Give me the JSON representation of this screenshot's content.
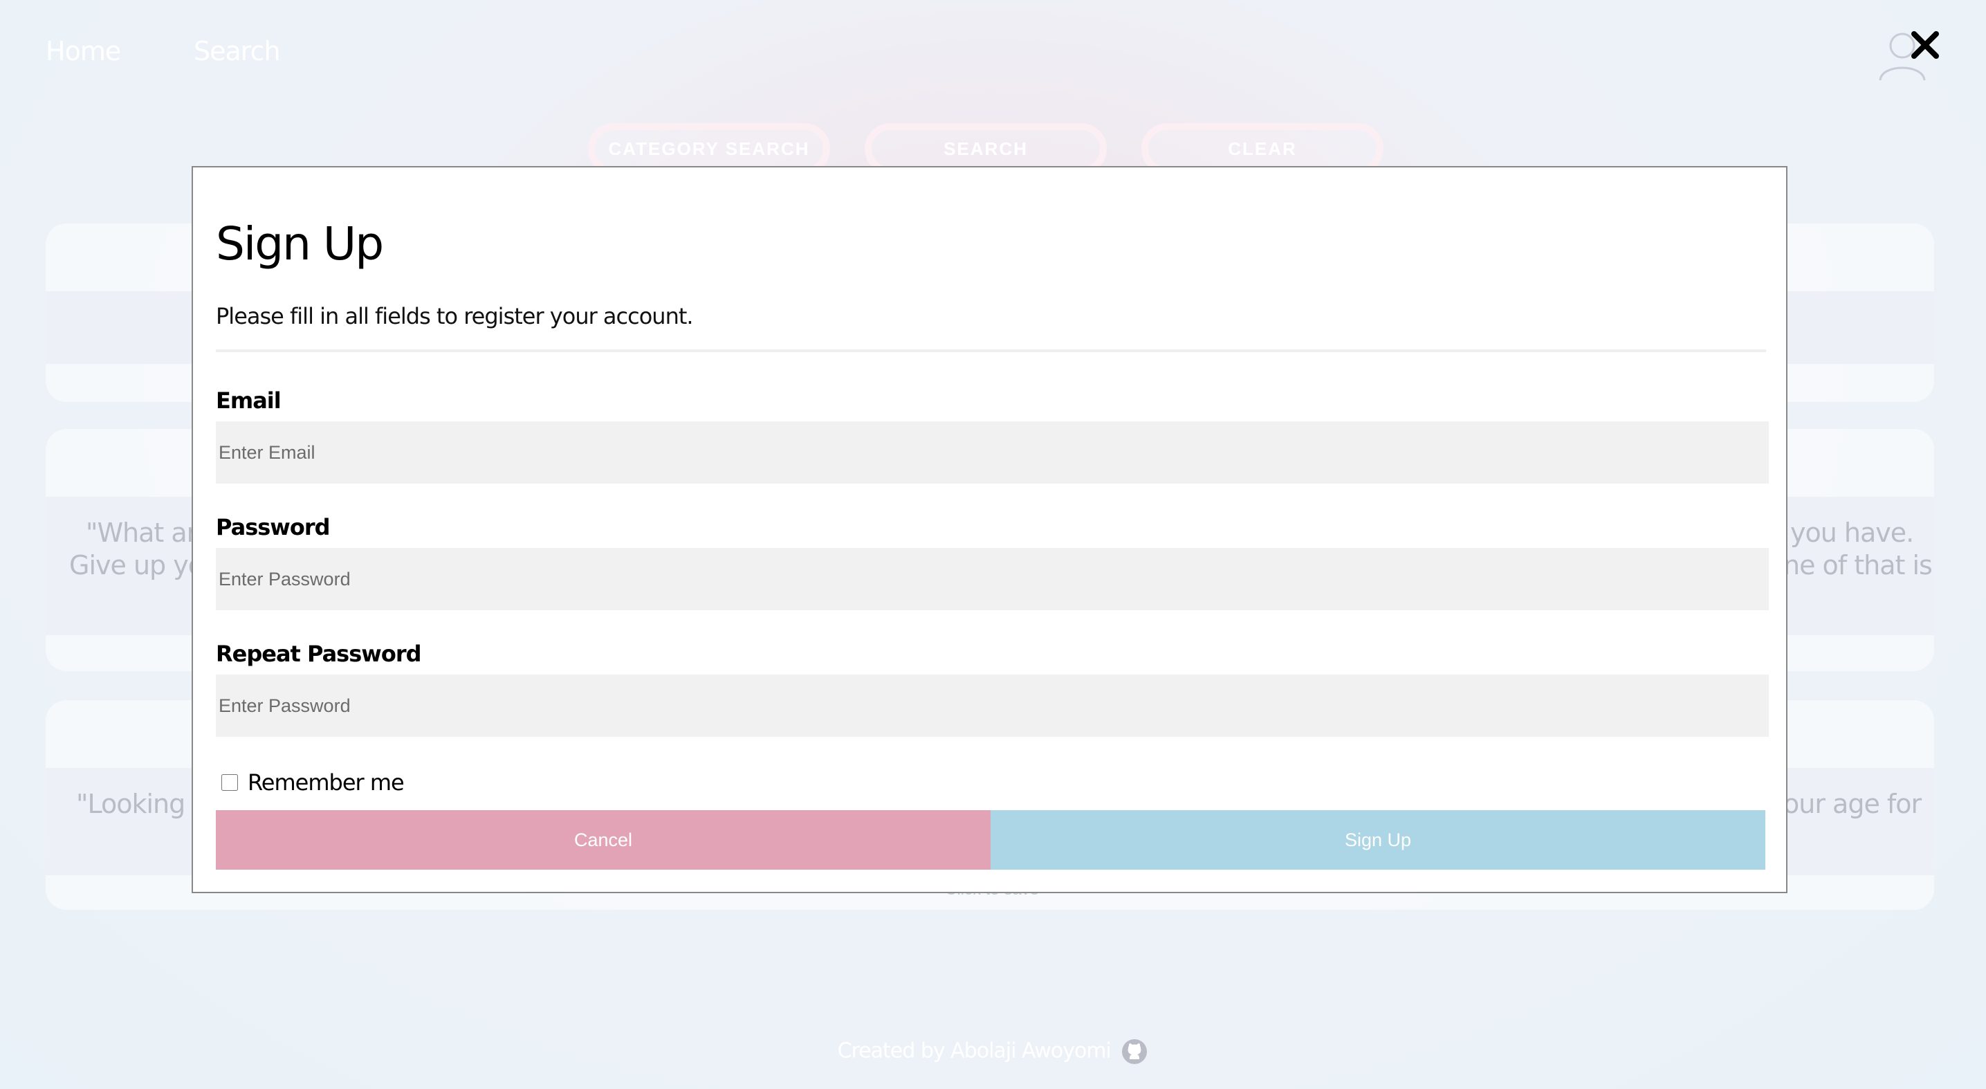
{
  "nav": {
    "home": "Home",
    "search": "Search"
  },
  "toolbar": {
    "category_search": "CATEGORY SEARCH",
    "search": "SEARCH",
    "clear": "CLEAR"
  },
  "background_text": {
    "quote2_left_line1": "\"What are",
    "quote2_left_line2": "Give up you",
    "quote2_right_line1": "you have.",
    "quote2_right_line2": "ne of that is",
    "quote3_left": "\"Looking b",
    "quote3_right": "our age for",
    "save_hint": "Click to save"
  },
  "footer": {
    "credit": "Created by Abolaji Awoyomi"
  },
  "modal": {
    "title": "Sign Up",
    "subtitle": "Please fill in all fields to register your account.",
    "email_label": "Email",
    "email_placeholder": "Enter Email",
    "password_label": "Password",
    "password_placeholder": "Enter Password",
    "repeat_label": "Repeat Password",
    "repeat_placeholder": "Enter Password",
    "remember_label": "Remember me",
    "remember_checked": false,
    "cancel_label": "Cancel",
    "signup_label": "Sign Up"
  },
  "colors": {
    "cancel_button": "#e2a3b7",
    "signup_button": "#acd5e6",
    "input_background": "#f1f1f1"
  },
  "icons": [
    "user-icon",
    "close-icon",
    "github-icon"
  ]
}
